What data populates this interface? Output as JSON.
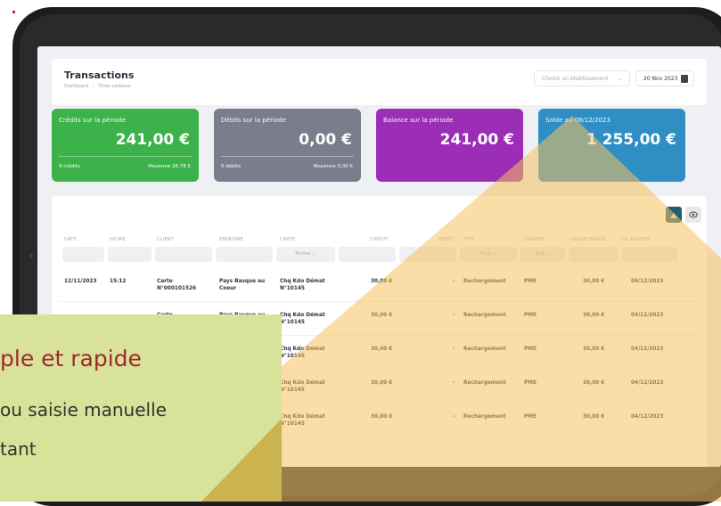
{
  "header": {
    "title": "Transactions",
    "breadcrumb": [
      "Dashboard",
      "-",
      "Titres cadeaux"
    ],
    "establishment_placeholder": "Choisir un établissement",
    "date": "20 Nov 2023"
  },
  "cards": [
    {
      "label": "Crédits sur la période",
      "amount": "241,00 €",
      "left": "9 crédits",
      "right": "Moyenne 26,78 €",
      "color": "#3bb34a"
    },
    {
      "label": "Débits sur la période",
      "amount": "0,00 €",
      "left": "0 débits",
      "right": "Moyenne 0,00 €",
      "color": "#7a7d8c"
    },
    {
      "label": "Balance sur la période",
      "amount": "241,00 €",
      "left": "",
      "right": "",
      "color": "#9c2db6"
    },
    {
      "label": "Solde au 08/12/2023",
      "amount": "1 255,00 €",
      "left": "",
      "right": "",
      "color": "#2f8fc4"
    }
  ],
  "table": {
    "columns": [
      "DATE",
      "HEURE",
      "CLIENT",
      "ENSEIGNE",
      "CARTE",
      "CRÉDIT",
      "DÉBIT",
      "TYPE",
      "ORIGINE",
      "SOLDE BADGE",
      "FIN VALIDITÉ"
    ],
    "filters": {
      "carte": "Toutes",
      "type": "Tous",
      "origine": "Tous"
    },
    "rows": [
      {
        "date": "12/11/2023",
        "heure": "15:12",
        "client": "Carte N°000101526",
        "enseigne": "Pays Basque au Coeur",
        "carte": "Chq Kdo Démat N°10145",
        "credit": "30,00 €",
        "debit": "-",
        "type": "Rechargement",
        "origine": "PME",
        "solde": "30,00 €",
        "fin": "04/12/2023"
      },
      {
        "date": "",
        "heure": "",
        "client": "Carte",
        "enseigne": "Pays Basque au",
        "carte": "Chq Kdo Démat N°10145",
        "credit": "30,00 €",
        "debit": "-",
        "type": "Rechargement",
        "origine": "PME",
        "solde": "30,00 €",
        "fin": "04/12/2023"
      },
      {
        "date": "",
        "heure": "",
        "client": "",
        "enseigne": "",
        "carte": "Chq Kdo Démat N°10145",
        "credit": "30,00 €",
        "debit": "-",
        "type": "Rechargement",
        "origine": "PME",
        "solde": "30,00 €",
        "fin": "04/12/2023"
      },
      {
        "date": "",
        "heure": "",
        "client": "",
        "enseigne": "",
        "carte": "Chq Kdo Démat N°10145",
        "credit": "30,00 €",
        "debit": "-",
        "type": "Rechargement",
        "origine": "PME",
        "solde": "30,00 €",
        "fin": "04/12/2023"
      },
      {
        "date": "",
        "heure": "",
        "client": "",
        "enseigne": "",
        "carte": "Chq Kdo Démat N°10145",
        "credit": "30,00 €",
        "debit": "-",
        "type": "Rechargement",
        "origine": "PME",
        "solde": "30,00 €",
        "fin": "04/12/2023"
      }
    ]
  },
  "callout": {
    "line1": "ple et rapide",
    "line2": "ou saisie manuelle",
    "line3": "tant",
    "accent_color": "#a0282f",
    "bg_color": "#d8e298"
  },
  "icons": {
    "export": "excel-export-icon",
    "view": "eye-icon",
    "calendar": "calendar-icon",
    "chevron": "chevron-down-icon"
  }
}
